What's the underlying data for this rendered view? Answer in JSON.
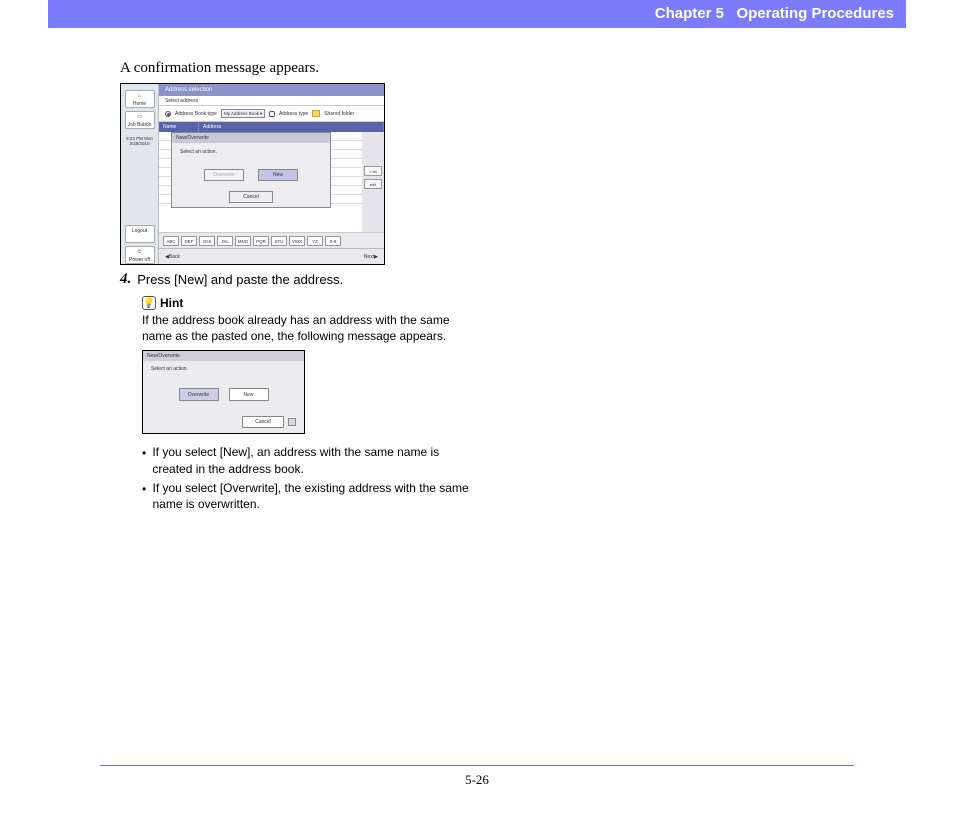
{
  "header": {
    "chapter": "Chapter 5",
    "title": "Operating Procedures"
  },
  "intro": "A confirmation message appears.",
  "screenshot1": {
    "sidebar": {
      "home": "Home",
      "job": "Job Button",
      "time": "9:23 PM  Mon\n3/28/2010",
      "logout": "Logout",
      "power": "Power off"
    },
    "window_title": "Address selection",
    "select_label": "Select address",
    "radio_label": "Address Book type",
    "dropdown1": "My Address Book",
    "type_label": "Address type",
    "folder_label": "Shared folder",
    "col_name": "Name",
    "col_addr": "Address",
    "dialog": {
      "title": "New/Overwrite",
      "msg": "Select an action.",
      "btn_overwrite": "Overwrite",
      "btn_new": "New",
      "btn_cancel": "Cancel"
    },
    "side_buttons": {
      "all": "» All",
      "edit": "edit"
    },
    "keys": [
      "ABC",
      "DEF",
      "GHI",
      "JKL",
      "MNO",
      "PQR",
      "STU",
      "VWX",
      "YZ",
      "0-9"
    ],
    "nav_back": "Back",
    "nav_next": "Next"
  },
  "step4": {
    "num": "4.",
    "text": "Press [New] and paste the address."
  },
  "hint": {
    "label": "Hint",
    "text": "If the address book already has an address with the same name as the pasted one, the following message appears."
  },
  "screenshot2": {
    "title": "New/Overwrite",
    "msg": "Select an action.",
    "btn_overwrite": "Overwrite",
    "btn_new": "New",
    "btn_cancel": "Cancel"
  },
  "bullets": [
    "If you select [New], an address with the same name is created in the address book.",
    "If you select [Overwrite], the existing address with the same name is overwritten."
  ],
  "page_number": "5-26"
}
